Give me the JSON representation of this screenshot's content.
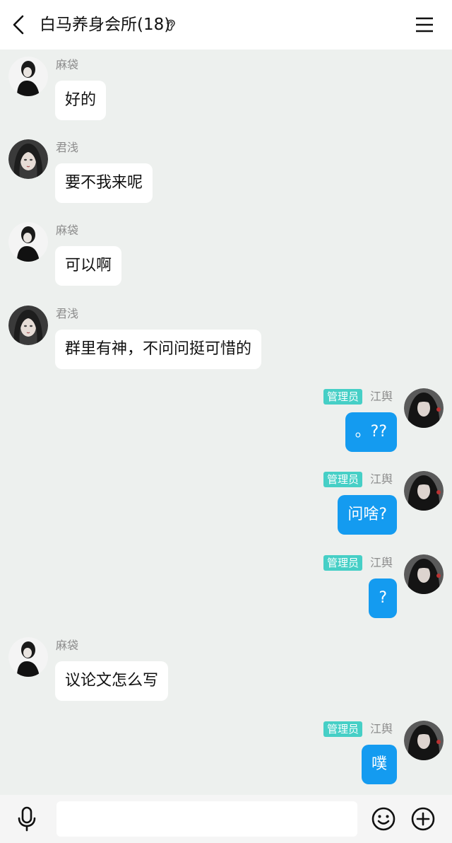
{
  "header": {
    "title": "白马养身会所(18)"
  },
  "messages": [
    {
      "side": "left",
      "name": "麻袋",
      "text": "好的",
      "avatar": "avatar-madai"
    },
    {
      "side": "left",
      "name": "君浅",
      "text": "要不我来呢",
      "avatar": "avatar-junqian"
    },
    {
      "side": "left",
      "name": "麻袋",
      "text": "可以啊",
      "avatar": "avatar-madai"
    },
    {
      "side": "left",
      "name": "君浅",
      "text": "群里有神，不问问挺可惜的",
      "avatar": "avatar-junqian"
    },
    {
      "side": "right",
      "name": "江舆",
      "badge": "管理员",
      "text": "。??",
      "avatar": "avatar-jiangyu"
    },
    {
      "side": "right",
      "name": "江舆",
      "badge": "管理员",
      "text": "问啥?",
      "avatar": "avatar-jiangyu"
    },
    {
      "side": "right",
      "name": "江舆",
      "badge": "管理员",
      "text": "?",
      "avatar": "avatar-jiangyu"
    },
    {
      "side": "left",
      "name": "麻袋",
      "text": "议论文怎么写",
      "avatar": "avatar-madai"
    },
    {
      "side": "right",
      "name": "江舆",
      "badge": "管理员",
      "text": "噗",
      "avatar": "avatar-jiangyu"
    }
  ],
  "input": {
    "value": "",
    "placeholder": ""
  },
  "icons": {
    "back": "back-arrow-icon",
    "ear": "ear-icon",
    "menu": "menu-icon",
    "mic": "microphone-icon",
    "emoji": "emoji-icon",
    "plus": "plus-icon"
  },
  "colors": {
    "background": "#edf0ee",
    "bubble_self": "#149bf0",
    "bubble_other": "#ffffff",
    "badge": "#46cfc6"
  }
}
